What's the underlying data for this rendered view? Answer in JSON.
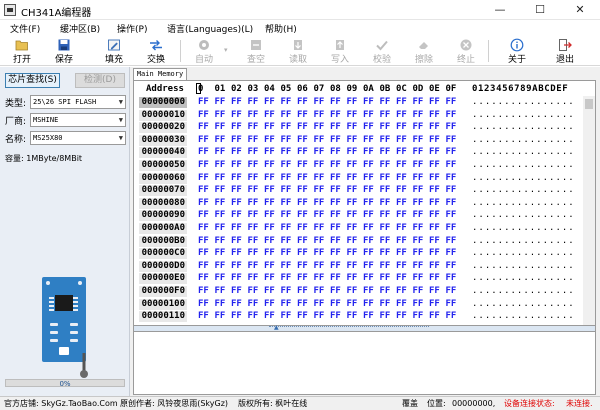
{
  "window": {
    "title": "CH341A编程器",
    "min_glyph": "—",
    "max_glyph": "☐",
    "close_glyph": "✕"
  },
  "menu": {
    "items": [
      {
        "label": "文件(F)"
      },
      {
        "label": "缓冲区(B)"
      },
      {
        "label": "操作(P)"
      },
      {
        "label": "语言(Languages)(L)"
      },
      {
        "label": "帮助(H)"
      }
    ]
  },
  "toolbar": {
    "items": [
      {
        "label": "打开",
        "icon": "folder-open-icon",
        "enabled": true
      },
      {
        "label": "保存",
        "icon": "floppy-disk-icon",
        "enabled": true
      },
      {
        "label": "填充",
        "icon": "edit-fill-icon",
        "enabled": true
      },
      {
        "label": "交换",
        "icon": "swap-arrows-icon",
        "enabled": true
      },
      {
        "label": "自动",
        "icon": "auto-gear-icon",
        "enabled": false
      },
      {
        "label": "查空",
        "icon": "blank-check-icon",
        "enabled": false
      },
      {
        "label": "读取",
        "icon": "read-icon",
        "enabled": false
      },
      {
        "label": "写入",
        "icon": "write-icon",
        "enabled": false
      },
      {
        "label": "校验",
        "icon": "verify-icon",
        "enabled": false
      },
      {
        "label": "擦除",
        "icon": "erase-icon",
        "enabled": false
      },
      {
        "label": "终止",
        "icon": "stop-icon",
        "enabled": false
      },
      {
        "label": "关于",
        "icon": "info-icon",
        "enabled": true
      },
      {
        "label": "退出",
        "icon": "exit-icon",
        "enabled": true
      }
    ]
  },
  "left_panel": {
    "detect_button": "芯片查找(S)",
    "check_button": "检测(D)",
    "type_label": "类型:",
    "type_value": "25\\26 SPI FLASH",
    "vendor_label": "厂商:",
    "vendor_value": "MSHINE",
    "name_label": "名称:",
    "name_value": "MS25X80",
    "capacity_label": "容量:",
    "capacity_value": "1MByte/8MBit",
    "progress_text": "0%",
    "progress_fraction": 0.0
  },
  "memory_view": {
    "tab_label": "Main Memory",
    "address_header": "Address",
    "byte_headers": [
      "0",
      "01",
      "02",
      "03",
      "04",
      "05",
      "06",
      "07",
      "08",
      "09",
      "0A",
      "0B",
      "0C",
      "0D",
      "0E",
      "0F"
    ],
    "ascii_header": "0123456789ABCDEF",
    "rows": [
      {
        "address": "00000000",
        "bytes": [
          "FF",
          "FF",
          "FF",
          "FF",
          "FF",
          "FF",
          "FF",
          "FF",
          "FF",
          "FF",
          "FF",
          "FF",
          "FF",
          "FF",
          "FF",
          "FF"
        ],
        "ascii": "................"
      },
      {
        "address": "00000010",
        "bytes": [
          "FF",
          "FF",
          "FF",
          "FF",
          "FF",
          "FF",
          "FF",
          "FF",
          "FF",
          "FF",
          "FF",
          "FF",
          "FF",
          "FF",
          "FF",
          "FF"
        ],
        "ascii": "................"
      },
      {
        "address": "00000020",
        "bytes": [
          "FF",
          "FF",
          "FF",
          "FF",
          "FF",
          "FF",
          "FF",
          "FF",
          "FF",
          "FF",
          "FF",
          "FF",
          "FF",
          "FF",
          "FF",
          "FF"
        ],
        "ascii": "................"
      },
      {
        "address": "00000030",
        "bytes": [
          "FF",
          "FF",
          "FF",
          "FF",
          "FF",
          "FF",
          "FF",
          "FF",
          "FF",
          "FF",
          "FF",
          "FF",
          "FF",
          "FF",
          "FF",
          "FF"
        ],
        "ascii": "................"
      },
      {
        "address": "00000040",
        "bytes": [
          "FF",
          "FF",
          "FF",
          "FF",
          "FF",
          "FF",
          "FF",
          "FF",
          "FF",
          "FF",
          "FF",
          "FF",
          "FF",
          "FF",
          "FF",
          "FF"
        ],
        "ascii": "................"
      },
      {
        "address": "00000050",
        "bytes": [
          "FF",
          "FF",
          "FF",
          "FF",
          "FF",
          "FF",
          "FF",
          "FF",
          "FF",
          "FF",
          "FF",
          "FF",
          "FF",
          "FF",
          "FF",
          "FF"
        ],
        "ascii": "................"
      },
      {
        "address": "00000060",
        "bytes": [
          "FF",
          "FF",
          "FF",
          "FF",
          "FF",
          "FF",
          "FF",
          "FF",
          "FF",
          "FF",
          "FF",
          "FF",
          "FF",
          "FF",
          "FF",
          "FF"
        ],
        "ascii": "................"
      },
      {
        "address": "00000070",
        "bytes": [
          "FF",
          "FF",
          "FF",
          "FF",
          "FF",
          "FF",
          "FF",
          "FF",
          "FF",
          "FF",
          "FF",
          "FF",
          "FF",
          "FF",
          "FF",
          "FF"
        ],
        "ascii": "................"
      },
      {
        "address": "00000080",
        "bytes": [
          "FF",
          "FF",
          "FF",
          "FF",
          "FF",
          "FF",
          "FF",
          "FF",
          "FF",
          "FF",
          "FF",
          "FF",
          "FF",
          "FF",
          "FF",
          "FF"
        ],
        "ascii": "................"
      },
      {
        "address": "00000090",
        "bytes": [
          "FF",
          "FF",
          "FF",
          "FF",
          "FF",
          "FF",
          "FF",
          "FF",
          "FF",
          "FF",
          "FF",
          "FF",
          "FF",
          "FF",
          "FF",
          "FF"
        ],
        "ascii": "................"
      },
      {
        "address": "000000A0",
        "bytes": [
          "FF",
          "FF",
          "FF",
          "FF",
          "FF",
          "FF",
          "FF",
          "FF",
          "FF",
          "FF",
          "FF",
          "FF",
          "FF",
          "FF",
          "FF",
          "FF"
        ],
        "ascii": "................"
      },
      {
        "address": "000000B0",
        "bytes": [
          "FF",
          "FF",
          "FF",
          "FF",
          "FF",
          "FF",
          "FF",
          "FF",
          "FF",
          "FF",
          "FF",
          "FF",
          "FF",
          "FF",
          "FF",
          "FF"
        ],
        "ascii": "................"
      },
      {
        "address": "000000C0",
        "bytes": [
          "FF",
          "FF",
          "FF",
          "FF",
          "FF",
          "FF",
          "FF",
          "FF",
          "FF",
          "FF",
          "FF",
          "FF",
          "FF",
          "FF",
          "FF",
          "FF"
        ],
        "ascii": "................"
      },
      {
        "address": "000000D0",
        "bytes": [
          "FF",
          "FF",
          "FF",
          "FF",
          "FF",
          "FF",
          "FF",
          "FF",
          "FF",
          "FF",
          "FF",
          "FF",
          "FF",
          "FF",
          "FF",
          "FF"
        ],
        "ascii": "................"
      },
      {
        "address": "000000E0",
        "bytes": [
          "FF",
          "FF",
          "FF",
          "FF",
          "FF",
          "FF",
          "FF",
          "FF",
          "FF",
          "FF",
          "FF",
          "FF",
          "FF",
          "FF",
          "FF",
          "FF"
        ],
        "ascii": "................"
      },
      {
        "address": "000000F0",
        "bytes": [
          "FF",
          "FF",
          "FF",
          "FF",
          "FF",
          "FF",
          "FF",
          "FF",
          "FF",
          "FF",
          "FF",
          "FF",
          "FF",
          "FF",
          "FF",
          "FF"
        ],
        "ascii": "................"
      },
      {
        "address": "00000100",
        "bytes": [
          "FF",
          "FF",
          "FF",
          "FF",
          "FF",
          "FF",
          "FF",
          "FF",
          "FF",
          "FF",
          "FF",
          "FF",
          "FF",
          "FF",
          "FF",
          "FF"
        ],
        "ascii": "................"
      },
      {
        "address": "00000110",
        "bytes": [
          "FF",
          "FF",
          "FF",
          "FF",
          "FF",
          "FF",
          "FF",
          "FF",
          "FF",
          "FF",
          "FF",
          "FF",
          "FF",
          "FF",
          "FF",
          "FF"
        ],
        "ascii": "................"
      }
    ]
  },
  "statusbar": {
    "shop": "官方店铺: SkyGz.TaoBao.Com",
    "author": "原创作者: 风铃夜思雨(SkyGz)",
    "copyright": "版权所有: 枫叶在线",
    "mode": "覆盖",
    "position_label": "位置:",
    "position_value": "00000000,",
    "device_status_label": "设备连接状态:",
    "device_status_value": "未连接."
  },
  "colors": {
    "hex_byte": "#2222ee",
    "status_red": "#e00000",
    "chip_board": "#2f7fc4"
  }
}
